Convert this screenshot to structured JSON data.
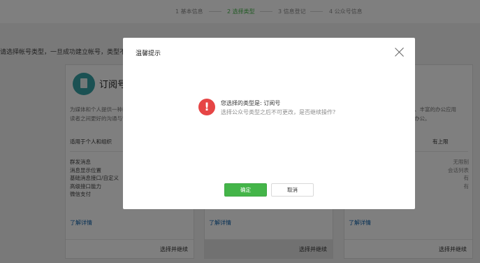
{
  "steps": [
    {
      "label": "1 基本信息",
      "active": false
    },
    {
      "label": "2 选择类型",
      "active": true
    },
    {
      "label": "3 信息登记",
      "active": false
    },
    {
      "label": "4 公众号信息",
      "active": false
    }
  ],
  "page_hint": "请选择帐号类型，一旦成功建立帐号，类型不",
  "cards": [
    {
      "name": "订阅号",
      "desc": "为媒体和个人提供一种新的信息传播方式，构建与读者之间更好的沟通与管理模式。",
      "suitable": "适用于个人和组织",
      "features": [
        {
          "label": "群发消息",
          "value": ""
        },
        {
          "label": "消息显示位置",
          "value": ""
        },
        {
          "label": "基础消息接口/自定义",
          "value": ""
        },
        {
          "label": "高级接口能力",
          "value": ""
        },
        {
          "label": "微信支付",
          "value": ""
        }
      ],
      "more": "了解详情",
      "action": "选择并继续"
    },
    {
      "more": "了解详情",
      "action": "选择并继续"
    },
    {
      "desc": "、丰富的办公应用\n办公。",
      "suitable": "有上限",
      "features": [
        {
          "label": "",
          "value": "无限制"
        },
        {
          "label": "",
          "value": "会话列表"
        },
        {
          "label": "",
          "value": "有"
        },
        {
          "label": "",
          "value": "有"
        }
      ],
      "more": "了解详情",
      "action": "选择并继续"
    }
  ],
  "dialog": {
    "title": "温馨提示",
    "icon": "!",
    "message": "您选择的类型是: 订阅号",
    "detail": "选择公众号类型之后不可更改，是否继续操作?",
    "confirm": "确定",
    "cancel": "取消"
  },
  "colors": {
    "accent": "#44b549",
    "link": "#0b5ea8",
    "warning": "#e64545"
  }
}
